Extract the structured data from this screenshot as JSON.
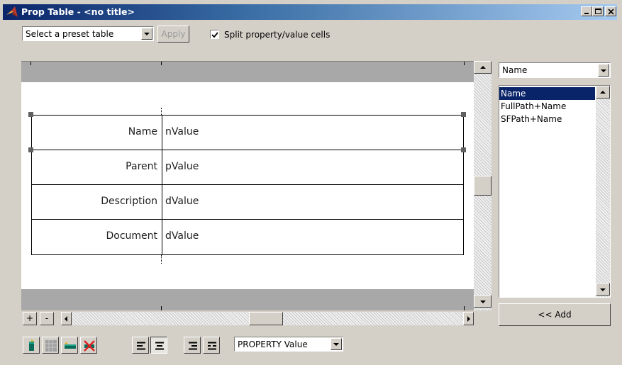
{
  "window": {
    "title": "Prop Table - <no title>"
  },
  "toolbar": {
    "preset": {
      "selected": "Select a preset table"
    },
    "apply_label": "Apply",
    "split_checkbox": {
      "label": "Split property/value cells",
      "checked": true
    }
  },
  "table": {
    "rows": [
      {
        "property": "Name",
        "value": "nValue"
      },
      {
        "property": "Parent",
        "value": "pValue"
      },
      {
        "property": "Description",
        "value": "dValue"
      },
      {
        "property": "Document",
        "value": "dValue"
      }
    ]
  },
  "bottom_controls": {
    "plus_label": "+",
    "minus_label": "-"
  },
  "right_panel": {
    "dropdown": {
      "selected": "Name"
    },
    "list_items": [
      "Name",
      "FullPath+Name",
      "SFPath+Name"
    ],
    "selected_index": 0,
    "add_label": "<< Add"
  },
  "bottom_toolbar": {
    "content_dropdown": {
      "selected": "PROPERTY Value"
    }
  },
  "colors": {
    "titlebar_start": "#0a246a",
    "titlebar_end": "#a6caf0",
    "face": "#d4d0c8",
    "selection": "#0a246a",
    "band": "#a8a8a8"
  }
}
